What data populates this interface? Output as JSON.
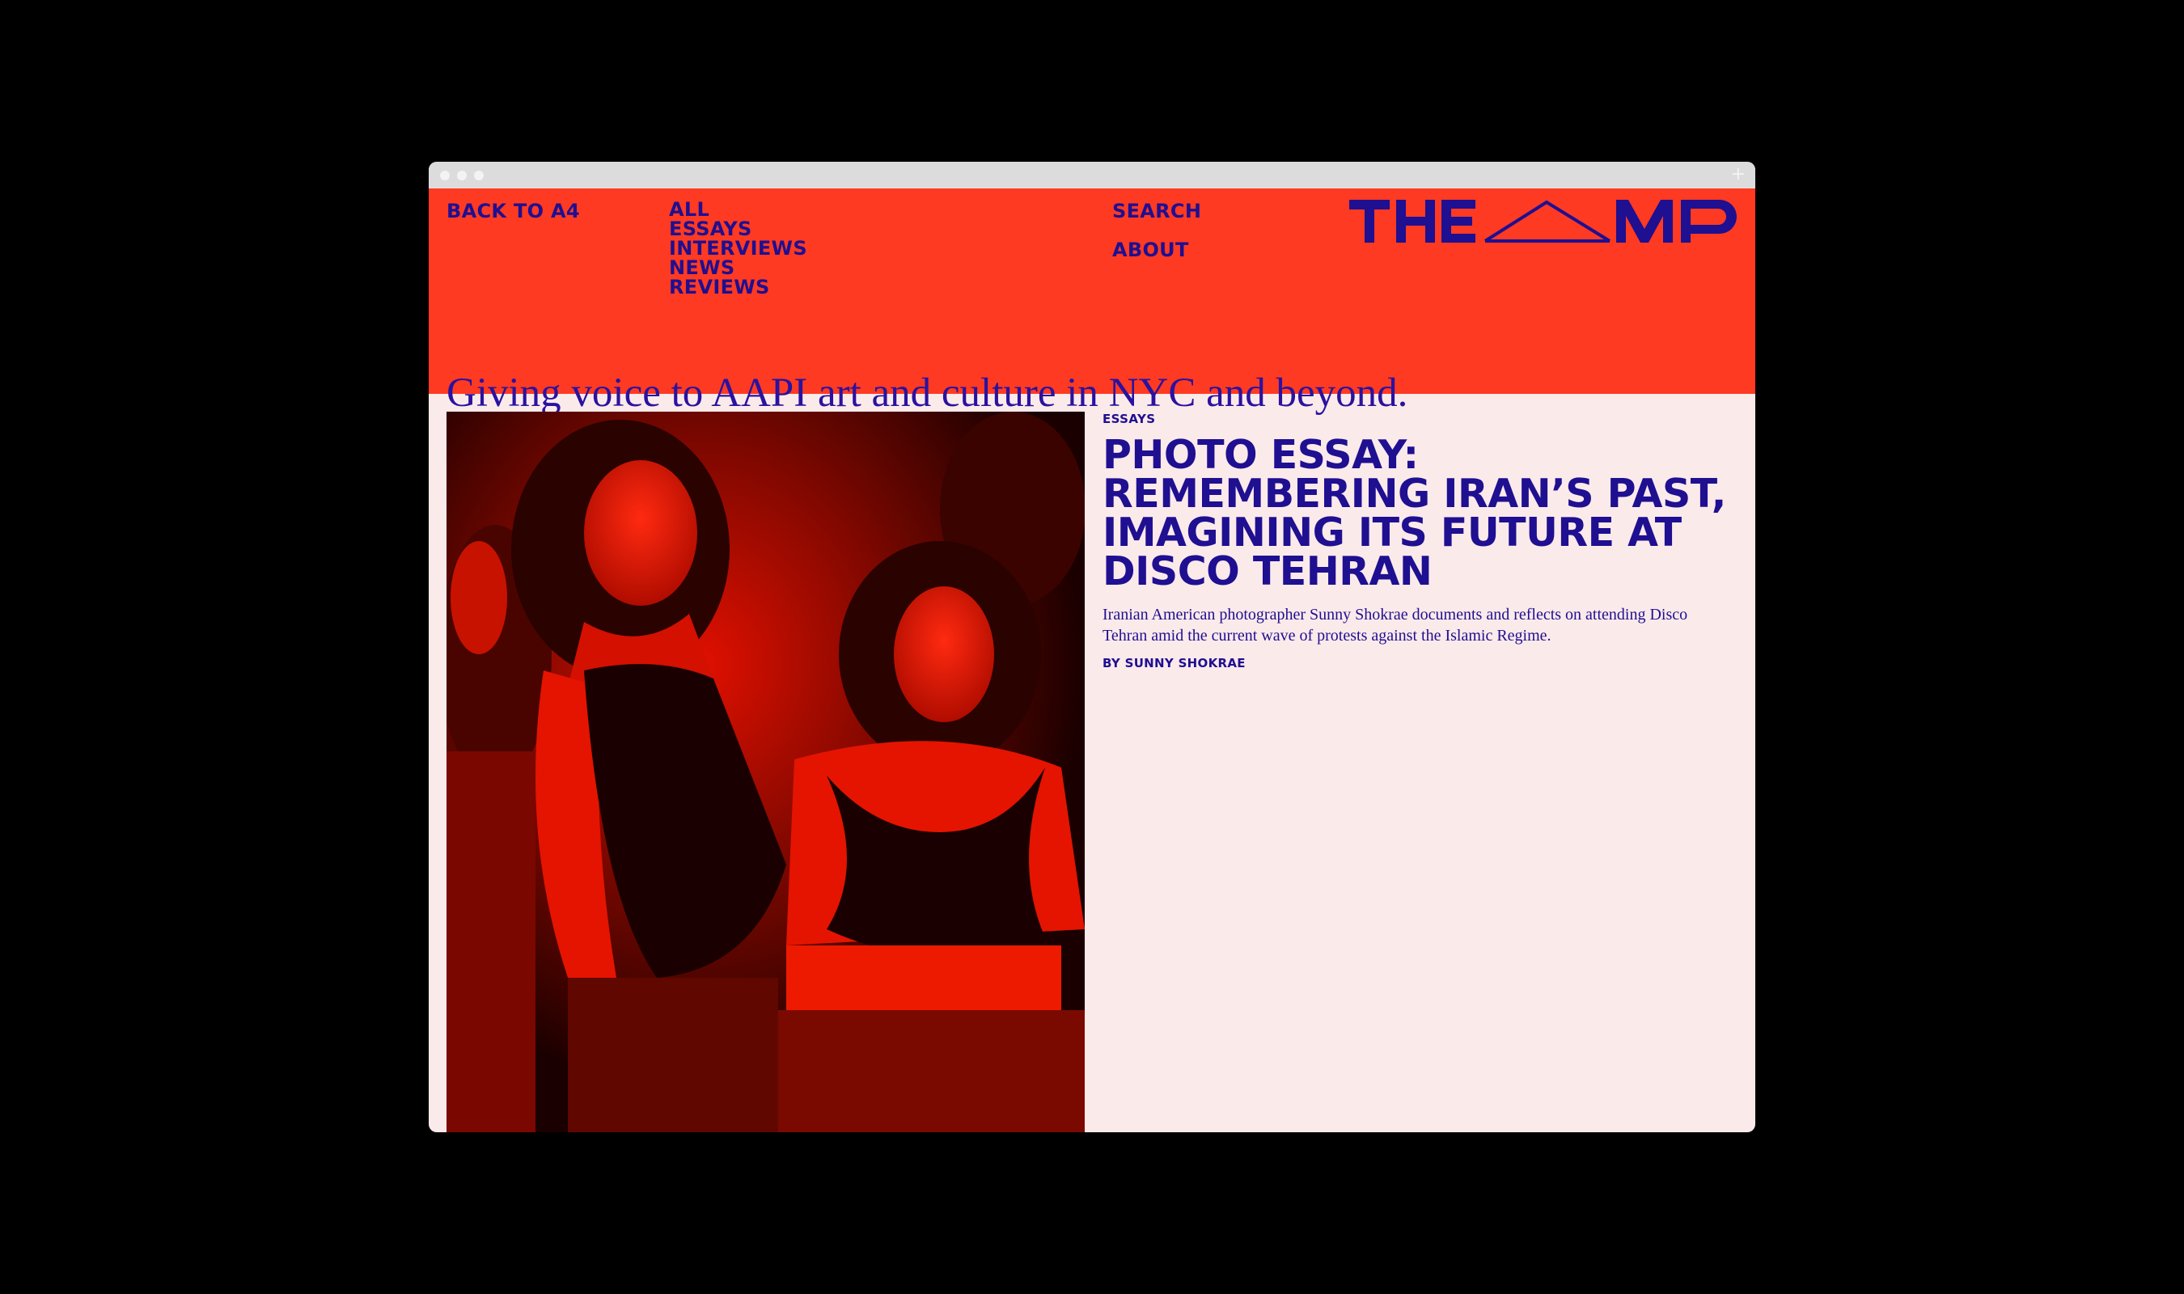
{
  "colors": {
    "page_background": "#000000",
    "header_red": "#ff3a22",
    "ink_indigo": "#1f0f91",
    "content_background": "#fbeaea",
    "browser_chrome": "#dcdcdc"
  },
  "browser": {
    "icons": [
      "window-dot-icon",
      "window-dot-icon",
      "window-dot-icon",
      "plus-icon"
    ],
    "new_tab_glyph": "+"
  },
  "header": {
    "back_link": "BACK TO A4",
    "categories": [
      "ALL",
      "ESSAYS",
      "INTERVIEWS",
      "NEWS",
      "REVIEWS"
    ],
    "utility": [
      "SEARCH",
      "ABOUT"
    ],
    "logo": "THE AMP",
    "tagline": "Giving voice to AAPI art and culture in NYC and beyond."
  },
  "featured": {
    "category": "ESSAYS",
    "title": "PHOTO ESSAY: REMEMBERING IRAN’S PAST, IMAGINING ITS FUTURE AT DISCO TEHRAN",
    "dek": "Iranian American photographer Sunny Shokrae documents and reflects on attending Disco Tehran amid the current wave of protests against the Islamic Regime.",
    "byline": "BY SUNNY SHOKRAE"
  }
}
